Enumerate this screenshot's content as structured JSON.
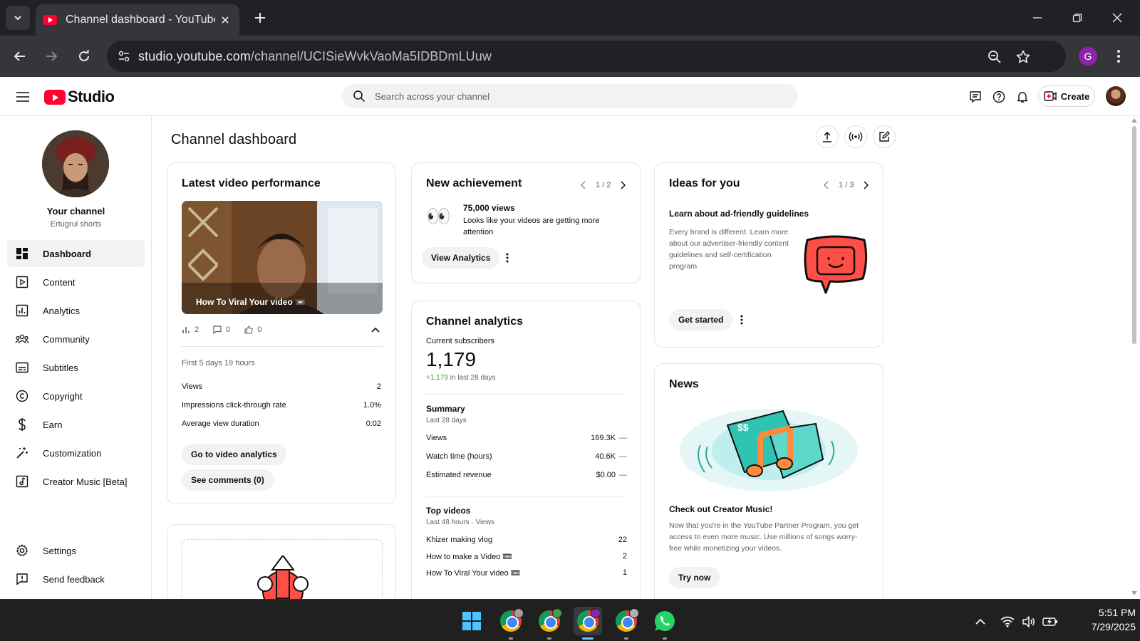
{
  "browser": {
    "tab_title": "Channel dashboard - YouTube Studio",
    "url_host": "studio.youtube.com",
    "url_path": "/channel/UCISieWvkVaoMa5IDBDmLUuw",
    "profile_initial": "G"
  },
  "studio": {
    "logo_text": "Studio",
    "search_placeholder": "Search across your channel",
    "create_label": "Create"
  },
  "sidebar": {
    "channel_title": "Your channel",
    "channel_handle": "Ertugrul shorts",
    "items": [
      {
        "label": "Dashboard",
        "icon": "dashboard-icon"
      },
      {
        "label": "Content",
        "icon": "content-icon"
      },
      {
        "label": "Analytics",
        "icon": "analytics-icon"
      },
      {
        "label": "Community",
        "icon": "community-icon"
      },
      {
        "label": "Subtitles",
        "icon": "subtitles-icon"
      },
      {
        "label": "Copyright",
        "icon": "copyright-icon"
      },
      {
        "label": "Earn",
        "icon": "dollar-icon"
      },
      {
        "label": "Customization",
        "icon": "magic-wand-icon"
      },
      {
        "label": "Creator Music [Beta]",
        "icon": "music-note-icon"
      }
    ],
    "settings_label": "Settings",
    "feedback_label": "Send feedback"
  },
  "main": {
    "page_title": "Channel dashboard",
    "latest": {
      "title": "Latest video performance",
      "video_title": "How To Viral Your video 📼",
      "views_count": "2",
      "comments_count": "0",
      "likes_count": "0",
      "period": "First 5 days 19 hours",
      "metrics": [
        {
          "label": "Views",
          "value": "2"
        },
        {
          "label": "Impressions click-through rate",
          "value": "1.0%"
        },
        {
          "label": "Average view duration",
          "value": "0:02"
        }
      ],
      "analytics_btn": "Go to video analytics",
      "comments_btn": "See comments (0)"
    },
    "achievement": {
      "title": "New achievement",
      "pager": "1 / 2",
      "heading": "75,000 views",
      "body": "Looks like your videos are getting more attention",
      "emoji": "👀",
      "button": "View Analytics"
    },
    "analytics": {
      "title": "Channel analytics",
      "subs_label": "Current subscribers",
      "subs_value": "1,179",
      "subs_delta": "+1,179",
      "subs_delta_suffix": " in last 28 days",
      "summary_title": "Summary",
      "summary_period": "Last 28 days",
      "summary": [
        {
          "label": "Views",
          "value": "169.3K",
          "trend": "—"
        },
        {
          "label": "Watch time (hours)",
          "value": "40.6K",
          "trend": "—"
        },
        {
          "label": "Estimated revenue",
          "value": "$0.00",
          "trend": "—"
        }
      ],
      "top_title": "Top videos",
      "top_period": "Last 48 hours · Views",
      "top": [
        {
          "title": "Khizer making vlog",
          "views": "22"
        },
        {
          "title": "How to make a Video 📼",
          "views": "2"
        },
        {
          "title": "How To Viral Your video 📼",
          "views": "1"
        }
      ]
    },
    "ideas": {
      "title": "Ideas for you",
      "pager": "1 / 3",
      "heading": "Learn about ad-friendly guidelines",
      "body": "Every brand is different. Learn more about our advertiser-friendly content guidelines and self-certification program",
      "button": "Get started"
    },
    "news": {
      "title": "News",
      "heading": "Check out Creator Music!",
      "body": "Now that you're in the YouTube Partner Program, you get access to even more music. Use millions of songs worry-free while monetizing your videos.",
      "button": "Try now"
    }
  },
  "taskbar": {
    "time": "5:51 PM",
    "date": "7/29/2025"
  },
  "colors": {
    "yt_red": "#ff0033",
    "positive_green": "#2ba640",
    "chrome_dark": "#202124",
    "news_teal": "#2fc4b2",
    "news_orange": "#ff8a3d"
  }
}
